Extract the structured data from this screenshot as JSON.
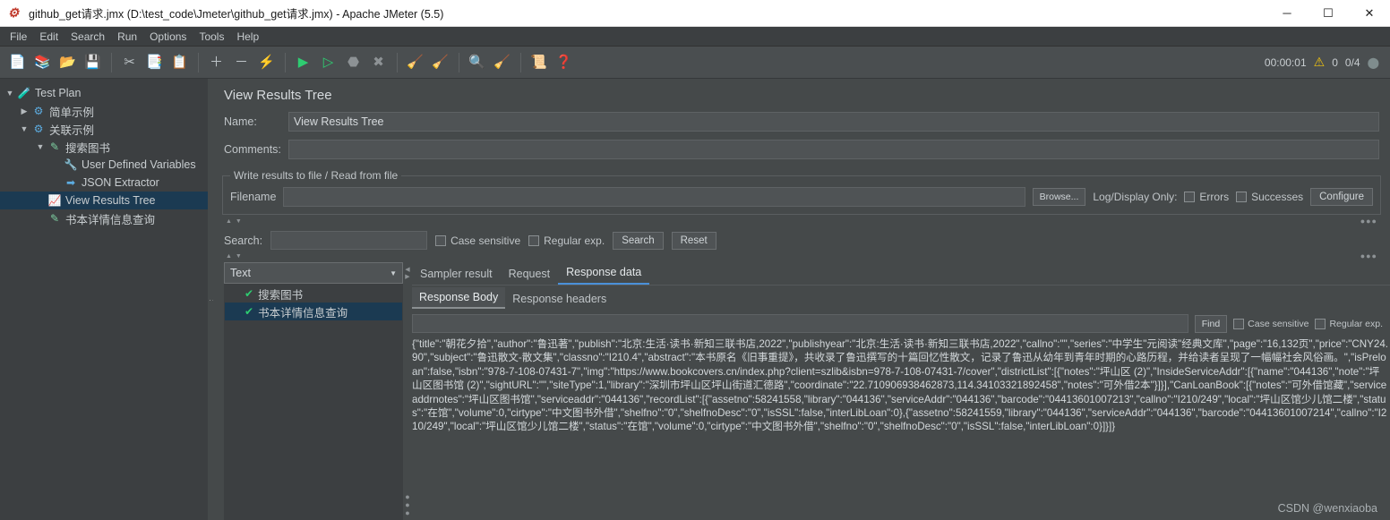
{
  "window": {
    "title": "github_get请求.jmx (D:\\test_code\\Jmeter\\github_get请求.jmx) - Apache JMeter (5.5)",
    "app_icon": "jmeter-feather-icon",
    "minimize": "─",
    "maximize": "☐",
    "close": "✕"
  },
  "menubar": [
    {
      "label": "File"
    },
    {
      "label": "Edit"
    },
    {
      "label": "Search"
    },
    {
      "label": "Run"
    },
    {
      "label": "Options"
    },
    {
      "label": "Tools"
    },
    {
      "label": "Help"
    }
  ],
  "toolbar": {
    "icons": [
      {
        "name": "new-icon",
        "glyph": "📄"
      },
      {
        "name": "templates-icon",
        "glyph": "📚"
      },
      {
        "name": "open-icon",
        "glyph": "📂"
      },
      {
        "name": "save-icon",
        "glyph": "💾"
      },
      {
        "name": "cut-icon",
        "glyph": "✂"
      },
      {
        "name": "copy-icon",
        "glyph": "📑"
      },
      {
        "name": "paste-icon",
        "glyph": "📋"
      },
      {
        "name": "expand-icon",
        "glyph": "＋"
      },
      {
        "name": "collapse-icon",
        "glyph": "－"
      },
      {
        "name": "toggle-icon",
        "glyph": "⚡"
      },
      {
        "name": "start-icon",
        "glyph": "▶"
      },
      {
        "name": "start-no-pause-icon",
        "glyph": "▷"
      },
      {
        "name": "stop-icon",
        "glyph": "⬣"
      },
      {
        "name": "shutdown-icon",
        "glyph": "✖"
      },
      {
        "name": "clear-icon",
        "glyph": "🧹"
      },
      {
        "name": "clear-all-icon",
        "glyph": "🧹"
      },
      {
        "name": "search-icon",
        "glyph": "🔍"
      },
      {
        "name": "reset-search-icon",
        "glyph": "🧹"
      },
      {
        "name": "function-helper-icon",
        "glyph": "📜"
      },
      {
        "name": "help-icon",
        "glyph": "❓"
      }
    ],
    "status": {
      "elapsed": "00:00:01",
      "warn_icon": "⚠",
      "error_count": "0",
      "threads": "0/4",
      "threads_icon": "⬤"
    }
  },
  "tree": {
    "nodes": [
      {
        "label": "Test Plan",
        "indent": 0,
        "toggle": "❯",
        "expanded": true,
        "icon": "🧪",
        "selected": false
      },
      {
        "label": "简单示例",
        "indent": 1,
        "toggle": "❯",
        "expanded": false,
        "icon": "⚙",
        "selected": false
      },
      {
        "label": "关联示例",
        "indent": 1,
        "toggle": "❯",
        "expanded": true,
        "icon": "⚙",
        "selected": false
      },
      {
        "label": "搜索图书",
        "indent": 2,
        "toggle": "❯",
        "expanded": true,
        "icon": "🖋",
        "selected": false
      },
      {
        "label": "User Defined Variables",
        "indent": 3,
        "toggle": "",
        "expanded": false,
        "icon": "🛠",
        "selected": false
      },
      {
        "label": "JSON Extractor",
        "indent": 3,
        "toggle": "",
        "expanded": false,
        "icon": "➡",
        "selected": false
      },
      {
        "label": "View Results Tree",
        "indent": 2,
        "toggle": "",
        "expanded": false,
        "icon": "📈",
        "selected": true
      },
      {
        "label": "书本详情信息查询",
        "indent": 2,
        "toggle": "",
        "expanded": false,
        "icon": "🖋",
        "selected": false
      }
    ]
  },
  "panel": {
    "title": "View Results Tree",
    "name_label": "Name:",
    "name_value": "View Results Tree",
    "comments_label": "Comments:",
    "comments_value": "",
    "file_group_legend": "Write results to file / Read from file",
    "filename_label": "Filename",
    "filename_value": "",
    "browse_label": "Browse...",
    "logdisplay_label": "Log/Display Only:",
    "errors_label": "Errors",
    "successes_label": "Successes",
    "configure_label": "Configure"
  },
  "search_bar": {
    "label": "Search:",
    "value": "",
    "case_sensitive_label": "Case sensitive",
    "regular_exp_label": "Regular exp.",
    "search_button": "Search",
    "reset_button": "Reset"
  },
  "results": {
    "renderer_selected": "Text",
    "renderer_caret": "▼",
    "items": [
      {
        "label": "搜索图书",
        "status_icon": "success-shield-icon",
        "selected": false
      },
      {
        "label": "书本详情信息查询",
        "status_icon": "success-shield-icon",
        "selected": true
      }
    ]
  },
  "viewer": {
    "tabs": [
      {
        "label": "Sampler result",
        "active": false
      },
      {
        "label": "Request",
        "active": false
      },
      {
        "label": "Response data",
        "active": true
      }
    ],
    "subtabs": [
      {
        "label": "Response Body",
        "active": true
      },
      {
        "label": "Response headers",
        "active": false
      }
    ],
    "find_value": "",
    "find_button": "Find",
    "case_sensitive_label": "Case sensitive",
    "regular_exp_label": "Regular exp.",
    "response_body": "{\"title\":\"朝花夕拾\",\"author\":\"鲁迅著\",\"publish\":\"北京:生活·读书·新知三联书店,2022\",\"publishyear\":\"北京:生活·读书·新知三联书店,2022\",\"callno\":\"\",\"series\":\"中学生\"元阅读\"经典文库\",\"page\":\"16,132页\",\"price\":\"CNY24.90\",\"subject\":\"鲁迅散文-散文集\",\"classno\":\"I210.4\",\"abstract\":\"本书原名《旧事重提》，共收录了鲁迅撰写的十篇回忆性散文，记录了鲁迅从幼年到青年时期的心路历程，并给读者呈现了一幅幅社会风俗画。\",\"isPreloan\":false,\"isbn\":\"978-7-108-07431-7\",\"img\":\"https://www.bookcovers.cn/index.php?client=szlib&isbn=978-7-108-07431-7/cover\",\"districtList\":[{\"notes\":\"坪山区 (2)\",\"InsideServiceAddr\":[{\"name\":\"044136\",\"note\":\"坪山区图书馆 (2)\",\"sightURL\":\"\",\"siteType\":1,\"library\":\"深圳市坪山区坪山街道汇德路\",\"coordinate\":\"22.710906938462873,114.34103321892458\",\"notes\":\"可外借2本\"}]}],\"CanLoanBook\":[{\"notes\":\"可外借馆藏\",\"serviceaddrnotes\":\"坪山区图书馆\",\"serviceaddr\":\"044136\",\"recordList\":[{\"assetno\":58241558,\"library\":\"044136\",\"serviceAddr\":\"044136\",\"barcode\":\"04413601007213\",\"callno\":\"I210/249\",\"local\":\"坪山区馆少儿馆二楼\",\"status\":\"在馆\",\"volume\":0,\"cirtype\":\"中文图书外借\",\"shelfno\":\"0\",\"shelfnoDesc\":\"0\",\"isSSL\":false,\"interLibLoan\":0},{\"assetno\":58241559,\"library\":\"044136\",\"serviceAddr\":\"044136\",\"barcode\":\"04413601007214\",\"callno\":\"I210/249\",\"local\":\"坪山区馆少儿馆二楼\",\"status\":\"在馆\",\"volume\":0,\"cirtype\":\"中文图书外借\",\"shelfno\":\"0\",\"shelfnoDesc\":\"0\",\"isSSL\":false,\"interLibLoan\":0}]}]}"
  },
  "watermark": "CSDN @wenxiaoba"
}
